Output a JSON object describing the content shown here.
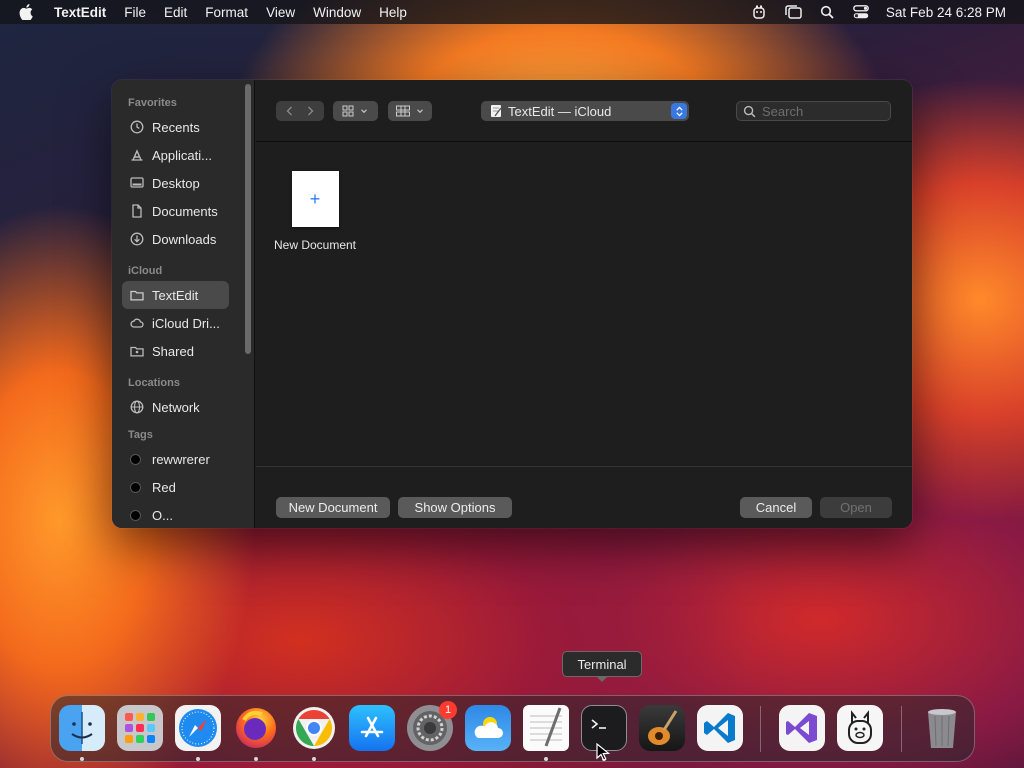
{
  "menubar": {
    "app_name": "TextEdit",
    "items": [
      "File",
      "Edit",
      "Format",
      "View",
      "Window",
      "Help"
    ],
    "clock": "Sat Feb 24  6:28 PM"
  },
  "sidebar": {
    "favorites_title": "Favorites",
    "favorites": [
      {
        "label": "Recents",
        "icon": "clock-icon"
      },
      {
        "label": "Applicati...",
        "icon": "applications-icon"
      },
      {
        "label": "Desktop",
        "icon": "desktop-icon"
      },
      {
        "label": "Documents",
        "icon": "document-icon"
      },
      {
        "label": "Downloads",
        "icon": "download-icon"
      }
    ],
    "icloud_title": "iCloud",
    "icloud": [
      {
        "label": "TextEdit",
        "icon": "folder-icon",
        "selected": true
      },
      {
        "label": "iCloud Dri...",
        "icon": "cloud-icon"
      },
      {
        "label": "Shared",
        "icon": "shared-folder-icon"
      }
    ],
    "locations_title": "Locations",
    "locations": [
      {
        "label": "Network",
        "icon": "globe-icon"
      }
    ],
    "tags_title": "Tags",
    "tags": [
      {
        "label": "rewwrerer",
        "color": "#000000"
      },
      {
        "label": "Red",
        "color": "#000000"
      },
      {
        "label": "O...",
        "color": "#000000"
      }
    ]
  },
  "toolbar": {
    "location": "TextEdit — iCloud",
    "search_placeholder": "Search"
  },
  "files": [
    {
      "name": "New Document",
      "icon": "plus-icon"
    }
  ],
  "buttons": {
    "new_document": "New Document",
    "show_options": "Show Options",
    "cancel": "Cancel",
    "open": "Open"
  },
  "tooltip": "Terminal",
  "dock": {
    "apps": [
      {
        "name": "Finder",
        "running": true
      },
      {
        "name": "Launchpad",
        "running": false
      },
      {
        "name": "Safari",
        "running": true
      },
      {
        "name": "Firefox",
        "running": true
      },
      {
        "name": "Chrome",
        "running": true
      },
      {
        "name": "App Store",
        "running": false
      },
      {
        "name": "System Settings",
        "running": false,
        "badge": "1"
      },
      {
        "name": "Weather",
        "running": false
      },
      {
        "name": "TextEdit",
        "running": true
      },
      {
        "name": "Terminal",
        "running": true
      },
      {
        "name": "GarageBand",
        "running": false
      },
      {
        "name": "Visual Studio Code",
        "running": false
      },
      {
        "name": "Visual Studio",
        "running": false
      },
      {
        "name": "Ollama",
        "running": false
      },
      {
        "name": "Trash",
        "running": false
      }
    ]
  },
  "colors": {
    "accent": "#3a78e0",
    "badge": "#ff3b30"
  }
}
